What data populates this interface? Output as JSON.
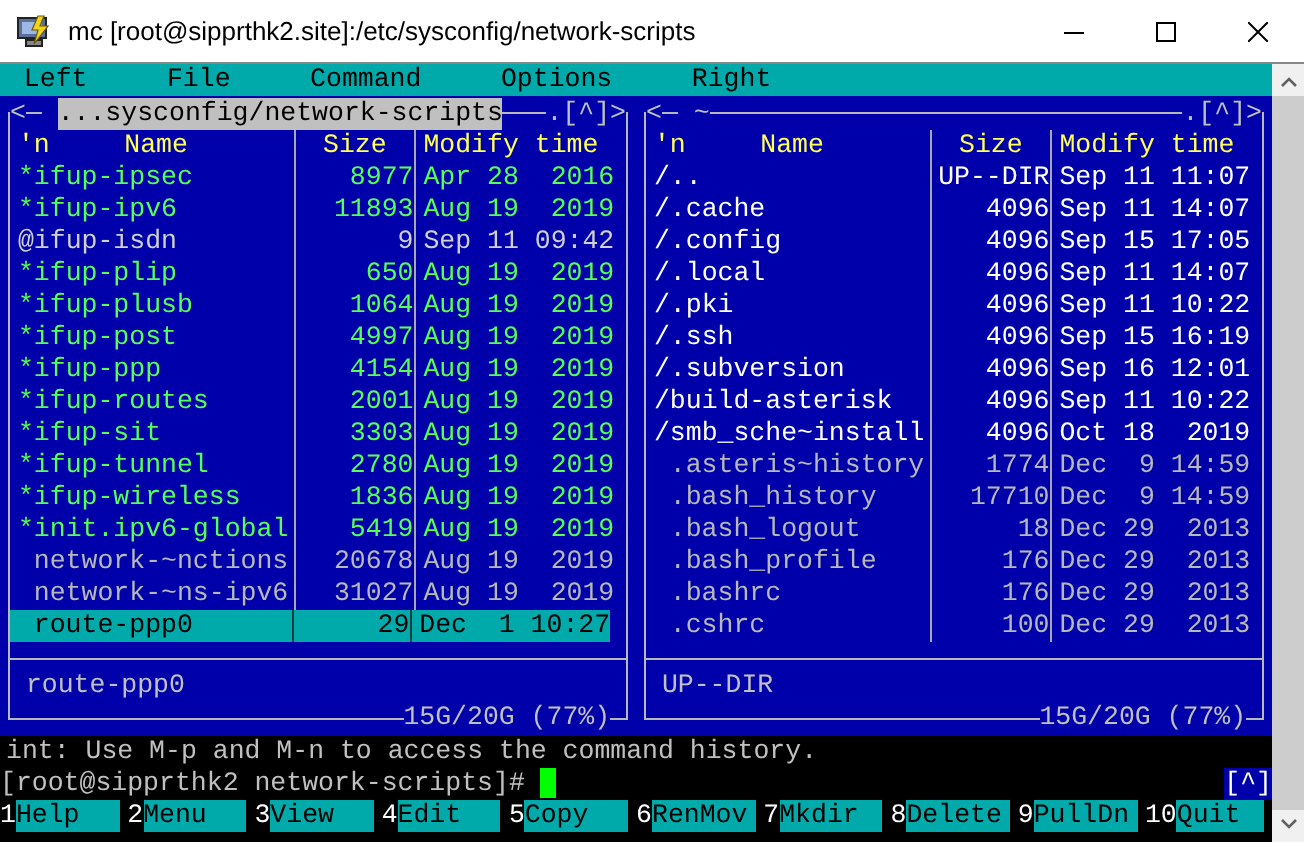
{
  "window": {
    "title": "mc [root@sipprthk2.site]:/etc/sysconfig/network-scripts"
  },
  "menu": [
    "Left",
    "File",
    "Command",
    "Options",
    "Right"
  ],
  "panels": [
    {
      "nav_left": "<",
      "path": "...sysconfig/network-scripts",
      "active": true,
      "nav_right": ".[^]>",
      "headers": {
        "sort": "'n",
        "name": "Name",
        "size": "Size",
        "time": "Modify time"
      },
      "files": [
        {
          "name": "*ifup-ipsec",
          "size": "8977",
          "modified": "Apr 28  2016",
          "kind": "executable",
          "selected": false
        },
        {
          "name": "*ifup-ipv6",
          "size": "11893",
          "modified": "Aug 19  2019",
          "kind": "executable",
          "selected": false
        },
        {
          "name": "@ifup-isdn",
          "size": "9",
          "modified": "Sep 11 09:42",
          "kind": "symlink",
          "selected": false
        },
        {
          "name": "*ifup-plip",
          "size": "650",
          "modified": "Aug 19  2019",
          "kind": "executable",
          "selected": false
        },
        {
          "name": "*ifup-plusb",
          "size": "1064",
          "modified": "Aug 19  2019",
          "kind": "executable",
          "selected": false
        },
        {
          "name": "*ifup-post",
          "size": "4997",
          "modified": "Aug 19  2019",
          "kind": "executable",
          "selected": false
        },
        {
          "name": "*ifup-ppp",
          "size": "4154",
          "modified": "Aug 19  2019",
          "kind": "executable",
          "selected": false
        },
        {
          "name": "*ifup-routes",
          "size": "2001",
          "modified": "Aug 19  2019",
          "kind": "executable",
          "selected": false
        },
        {
          "name": "*ifup-sit",
          "size": "3303",
          "modified": "Aug 19  2019",
          "kind": "executable",
          "selected": false
        },
        {
          "name": "*ifup-tunnel",
          "size": "2780",
          "modified": "Aug 19  2019",
          "kind": "executable",
          "selected": false
        },
        {
          "name": "*ifup-wireless",
          "size": "1836",
          "modified": "Aug 19  2019",
          "kind": "executable",
          "selected": false
        },
        {
          "name": "*init.ipv6-global",
          "size": "5419",
          "modified": "Aug 19  2019",
          "kind": "executable",
          "selected": false
        },
        {
          "name": "network-~nctions",
          "size": "20678",
          "modified": "Aug 19  2019",
          "kind": "file",
          "selected": false
        },
        {
          "name": "network-~ns-ipv6",
          "size": "31027",
          "modified": "Aug 19  2019",
          "kind": "file",
          "selected": false
        },
        {
          "name": "route-ppp0",
          "size": "29",
          "modified": "Dec  1 10:27",
          "kind": "file",
          "selected": true
        }
      ],
      "mini_status": "route-ppp0",
      "disk_usage": "15G/20G (77%)"
    },
    {
      "nav_left": "<",
      "path": "~",
      "active": false,
      "nav_right": ".[^]>",
      "headers": {
        "sort": "'n",
        "name": "Name",
        "size": "Size",
        "time": "Modify time"
      },
      "files": [
        {
          "name": "/..",
          "size": "UP--DIR",
          "modified": "Sep 11 11:07",
          "kind": "directory",
          "selected": false
        },
        {
          "name": "/.cache",
          "size": "4096",
          "modified": "Sep 11 14:07",
          "kind": "directory",
          "selected": false
        },
        {
          "name": "/.config",
          "size": "4096",
          "modified": "Sep 15 17:05",
          "kind": "directory",
          "selected": false
        },
        {
          "name": "/.local",
          "size": "4096",
          "modified": "Sep 11 14:07",
          "kind": "directory",
          "selected": false
        },
        {
          "name": "/.pki",
          "size": "4096",
          "modified": "Sep 11 10:22",
          "kind": "directory",
          "selected": false
        },
        {
          "name": "/.ssh",
          "size": "4096",
          "modified": "Sep 15 16:19",
          "kind": "directory",
          "selected": false
        },
        {
          "name": "/.subversion",
          "size": "4096",
          "modified": "Sep 16 12:01",
          "kind": "directory",
          "selected": false
        },
        {
          "name": "/build-asterisk",
          "size": "4096",
          "modified": "Sep 11 10:22",
          "kind": "directory",
          "selected": false
        },
        {
          "name": "/smb_sche~install",
          "size": "4096",
          "modified": "Oct 18  2019",
          "kind": "directory",
          "selected": false
        },
        {
          "name": ".asteris~history",
          "size": "1774",
          "modified": "Dec  9 14:59",
          "kind": "file",
          "selected": false
        },
        {
          "name": ".bash_history",
          "size": "17710",
          "modified": "Dec  9 14:59",
          "kind": "file",
          "selected": false
        },
        {
          "name": ".bash_logout",
          "size": "18",
          "modified": "Dec 29  2013",
          "kind": "file",
          "selected": false
        },
        {
          "name": ".bash_profile",
          "size": "176",
          "modified": "Dec 29  2013",
          "kind": "file",
          "selected": false
        },
        {
          "name": ".bashrc",
          "size": "176",
          "modified": "Dec 29  2013",
          "kind": "file",
          "selected": false
        },
        {
          "name": ".cshrc",
          "size": "100",
          "modified": "Dec 29  2013",
          "kind": "file",
          "selected": false
        }
      ],
      "mini_status": "UP--DIR",
      "disk_usage": "15G/20G (77%)"
    }
  ],
  "hint": "int: Use M-p and M-n to access the command history.",
  "prompt": "[root@sipprthk2 network-scripts]#",
  "history_button": "[^]",
  "keybar": [
    {
      "key": "1",
      "label": "Help"
    },
    {
      "key": "2",
      "label": "Menu"
    },
    {
      "key": "3",
      "label": "View"
    },
    {
      "key": "4",
      "label": "Edit"
    },
    {
      "key": "5",
      "label": "Copy"
    },
    {
      "key": "6",
      "label": "RenMov"
    },
    {
      "key": "7",
      "label": "Mkdir"
    },
    {
      "key": "8",
      "label": "Delete"
    },
    {
      "key": "9",
      "label": "PullDn"
    },
    {
      "key": "10",
      "label": "Quit"
    }
  ]
}
